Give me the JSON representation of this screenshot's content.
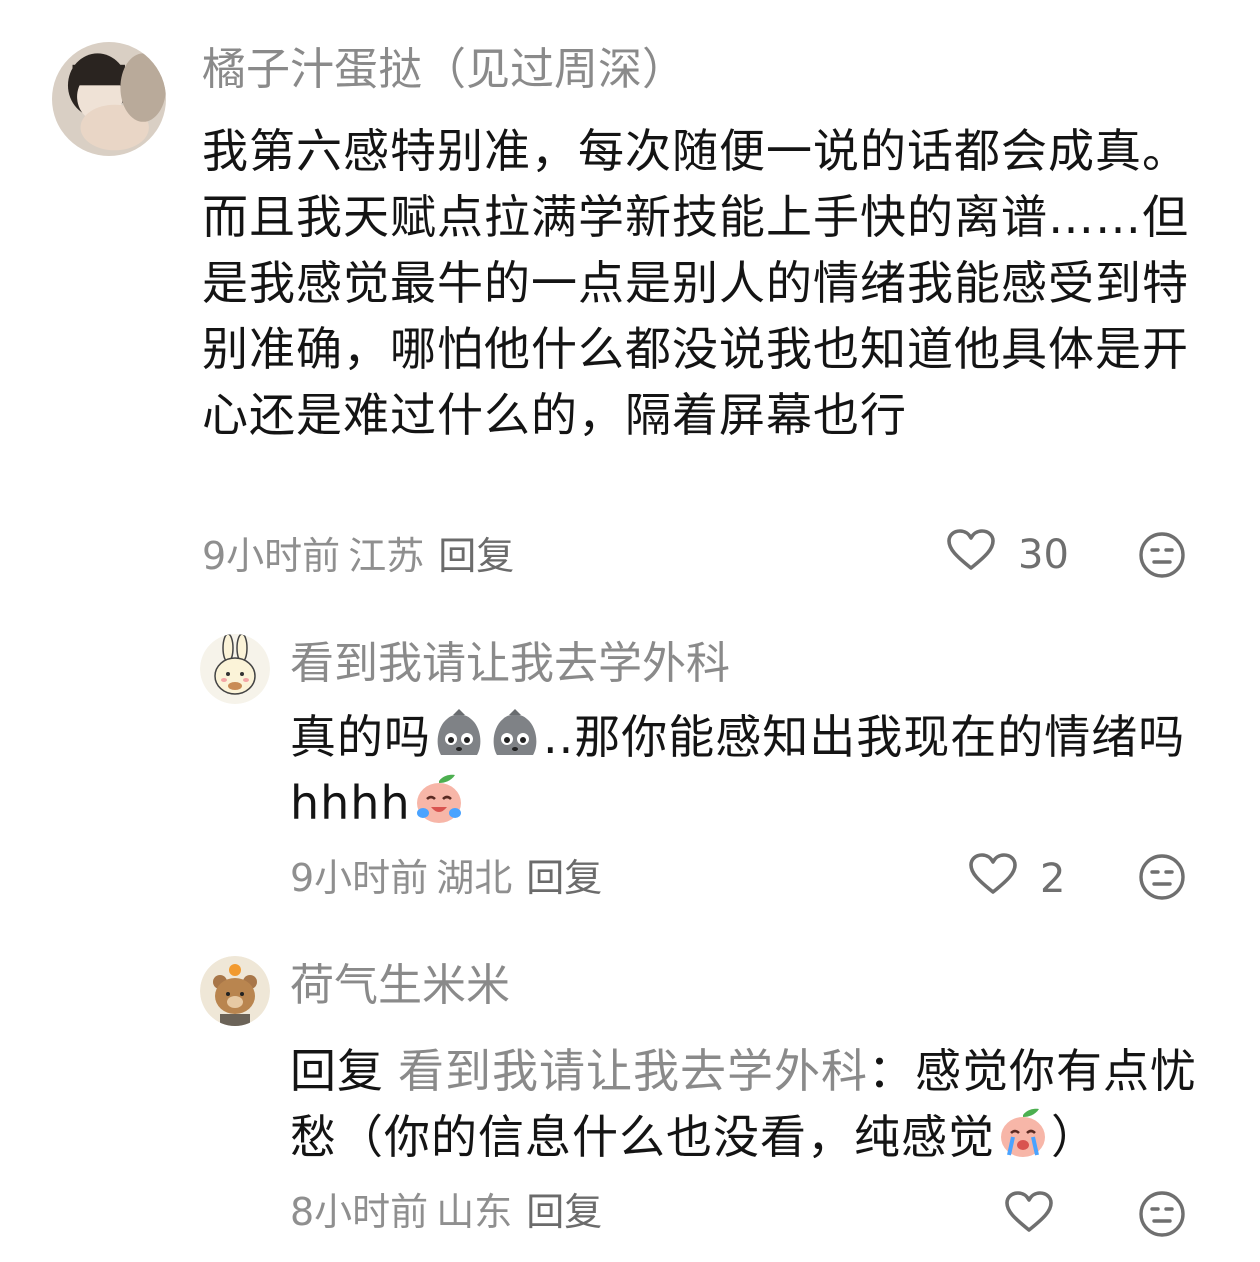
{
  "comments": [
    {
      "username": "橘子汁蛋挞（见过周深）",
      "text": "我第六感特别准，每次随便一说的话都会成真。而且我天赋点拉满学新技能上手快的离谱……但是我感觉最牛的一点是别人的情绪我能感受到特别准确，哪怕他什么都没说我也知道他具体是开心还是难过什么的，隔着屏幕也行",
      "time": "9小时前",
      "location": "江苏",
      "reply_label": "回复",
      "likes": "30"
    },
    {
      "username": "看到我请让我去学外科",
      "text_a": "真的吗",
      "text_b": "..那你能感知出我现在的情绪吗",
      "text_c": "hhhh",
      "time": "9小时前",
      "location": "湖北",
      "reply_label": "回复",
      "likes": "2"
    },
    {
      "username": "荷气生米米",
      "reply_prefix": "回复",
      "reply_target": "看到我请让我去学外科",
      "text_a": "：感觉你有点忧愁（你的信息什么也没看，纯感觉",
      "text_b": "）",
      "time": "8小时前",
      "location": "山东",
      "reply_label": "回复"
    }
  ],
  "icons": {
    "like": "heart-outline-icon",
    "dislike": "meh-face-icon",
    "emoji_rock": "rock-face-emoji",
    "emoji_peach_cry": "peach-crying-laugh-emoji"
  },
  "colors": {
    "text": "#141414",
    "username": "#8a8a8a",
    "meta": "#8f8f8f",
    "icon": "#6f6f6f"
  }
}
